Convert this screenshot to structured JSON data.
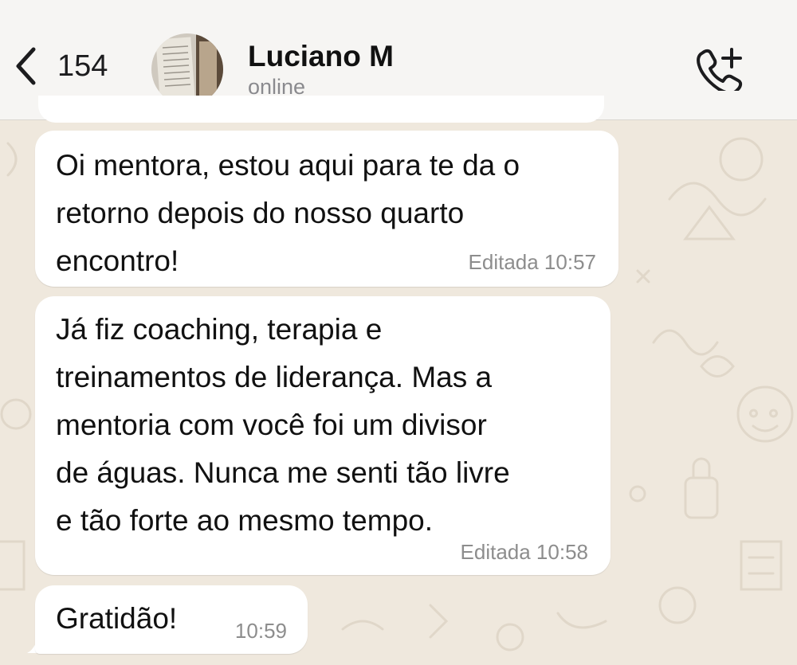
{
  "header": {
    "back_count": "154",
    "contact_name": "Luciano M",
    "contact_status": "online"
  },
  "messages": [
    {
      "text": "Oi mentora, estou aqui para te da o\nretorno depois do nosso quarto\nencontro!",
      "meta": "Editada 10:57"
    },
    {
      "text": "Já fiz coaching, terapia e\ntreinamentos de liderança. Mas a\nmentoria com você foi um divisor\nde águas. Nunca me senti tão livre\ne tão forte ao mesmo tempo.",
      "meta": "Editada 10:58"
    },
    {
      "text": "Gratidão!",
      "meta": "10:59"
    }
  ],
  "colors": {
    "wallpaper": "#efe8dd",
    "header_bg": "#f6f5f3",
    "bubble_bg": "#ffffff",
    "meta_text": "#8d8d8d"
  },
  "icons": [
    "chevron-left-icon",
    "avatar",
    "phone-add-icon"
  ]
}
